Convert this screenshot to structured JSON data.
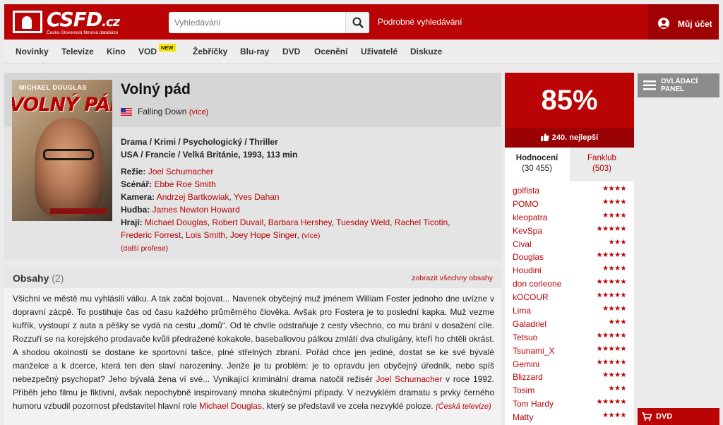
{
  "header": {
    "logo_text": "CSFD",
    "logo_tld": ".cz",
    "logo_subtitle": "Česko-Slovenská filmová databáze",
    "search_placeholder": "Vyhledávání",
    "advanced_search": "Podrobné vyhledávání",
    "account": "Můj účet"
  },
  "nav": {
    "items": [
      "Novinky",
      "Televize",
      "Kino",
      "VOD",
      "Žebříčky",
      "Blu-ray",
      "DVD",
      "Ocenění",
      "Uživatelé",
      "Diskuze"
    ],
    "new_badge": "NEW"
  },
  "film": {
    "poster_name": "MICHAEL DOUGLAS",
    "poster_title": "VOLNÝ PÁD",
    "title": "Volný pád",
    "original_title": "Falling Down",
    "more": "(více)",
    "genres": "Drama / Krimi / Psychologický / Thriller",
    "origin": "USA / Francie / Velká Británie, 1993, 113 min",
    "credits": {
      "directing_label": "Režie:",
      "director": "Joel Schumacher",
      "screenplay_label": "Scénář:",
      "writer": "Ebbe Roe Smith",
      "camera_label": "Kamera:",
      "camera": [
        "Andrzej Bartkowiak",
        "Yves Dahan"
      ],
      "music_label": "Hudba:",
      "music": "James Newton Howard",
      "cast_label": "Hrají:",
      "cast": [
        "Michael Douglas",
        "Robert Duvall",
        "Barbara Hershey",
        "Tuesday Weld",
        "Rachel Ticotin",
        "Frederic Forrest",
        "Lois Smith",
        "Joey Hope Singer"
      ],
      "more": "(více)",
      "more_professions": "(další profese)"
    }
  },
  "plots": {
    "title": "Obsahy",
    "count": "(2)",
    "show_all": "zobrazit všechny obsahy",
    "text_1": "Všichni ve městě mu vyhlásili válku. A tak začal bojovat... Navenek obyčejný muž jménem William Foster jednoho dne uvízne v dopravní zácpě. To postihuje čas od času každého průměrného člověka. Avšak pro Fostera je to poslední kapka. Muž vezme kufřík, vystoupí z auta a pěšky se vydá na cestu „domů“. Od té chvíle odstraňuje z cesty všechno, co mu brání v dosažení cíle. Rozzuří se na korejského prodavače kvůli předražené kokakole, baseballovou pálkou zmlátí dva chuligány, kteří ho chtěli okrást. A shodou okolností se dostane ke sportovní tašce, plné střelných zbraní. Pořád chce jen jediné, dostat se ke své bývalé manželce a k dcerce, která ten den slaví narozeniny. Jenže je tu problém: je to opravdu jen obyčejný úředník, nebo spíš nebezpečný psychopat? Jeho bývalá žena ví své... Vynikající kriminální drama natočil režisér ",
    "director_link": "Joel Schumacher",
    "text_2": " v roce 1992. Příběh jeho filmu je fiktivní, avšak nepochybně inspirovaný mnoha skutečnými případy. V nezvyklém dramatu s prvky černého humoru vzbudil pozornost představitel hlavní role ",
    "actor_link": "Michael Douglas",
    "text_3": ", který se představil ve zcela nezvyklé poloze. ",
    "source": "(Česká televize)"
  },
  "rating": {
    "percent": "85%",
    "rank": "240. nejlepší",
    "tab_ratings": "Hodnocení",
    "tab_ratings_count": "(30 455)",
    "tab_fanclub": "Fanklub",
    "tab_fanclub_count": "(503)",
    "users": [
      {
        "name": "golfista",
        "stars": "★★★★"
      },
      {
        "name": "POMO",
        "stars": "★★★★"
      },
      {
        "name": "kleopatra",
        "stars": "★★★★"
      },
      {
        "name": "KevSpa",
        "stars": "★★★★★"
      },
      {
        "name": "Cival",
        "stars": "★★★"
      },
      {
        "name": "Douglas",
        "stars": "★★★★★"
      },
      {
        "name": "Houdini",
        "stars": "★★★★"
      },
      {
        "name": "don corleone",
        "stars": "★★★★★"
      },
      {
        "name": "kOCOUR",
        "stars": "★★★★★"
      },
      {
        "name": "Lima",
        "stars": "★★★★"
      },
      {
        "name": "Galadriel",
        "stars": "★★★"
      },
      {
        "name": "Tetsuo",
        "stars": "★★★★★"
      },
      {
        "name": "Tsunami_X",
        "stars": "★★★★★"
      },
      {
        "name": "Gemini",
        "stars": "★★★★★"
      },
      {
        "name": "Blizzard",
        "stars": "★★★★"
      },
      {
        "name": "Tosim",
        "stars": "★★★"
      },
      {
        "name": "Tom Hardy",
        "stars": "★★★★★"
      },
      {
        "name": "Matty",
        "stars": "★★★★"
      }
    ]
  },
  "side": {
    "control_panel": "OVLÁDACÍ PANEL",
    "dvd": "DVD"
  },
  "colors": {
    "brand_red": "#ba0305",
    "dark_red": "#9a0204",
    "grey_panel": "#8c8c8c"
  }
}
